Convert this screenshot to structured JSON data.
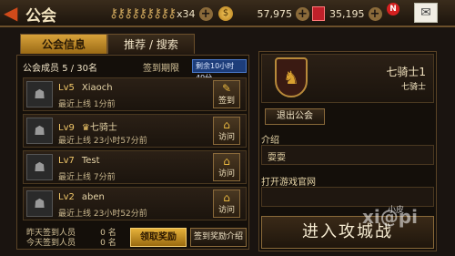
{
  "topbar": {
    "title": "公会",
    "key_count": "x34",
    "gold": "57,975",
    "gems": "35,195",
    "notice_badge": "N"
  },
  "tabs": [
    {
      "label": "公会信息",
      "active": true
    },
    {
      "label": "推荐 / 搜索",
      "active": false
    }
  ],
  "member_list": {
    "members_label": "公会成员",
    "members_count": "5 / 30名",
    "deadline_label": "签到期限",
    "remaining": "剩余10小时49分",
    "rows": [
      {
        "level": "Lv5",
        "name": "Xiaoch",
        "last_online": "最近上线 1分前",
        "action": "签到",
        "action_icon": "✎",
        "crown": ""
      },
      {
        "level": "Lv9",
        "name": "七骑士",
        "last_online": "最近上线 23小时57分前",
        "action": "访问",
        "action_icon": "⌂",
        "crown": "♛"
      },
      {
        "level": "Lv7",
        "name": "Test",
        "last_online": "最近上线 7分前",
        "action": "访问",
        "action_icon": "⌂",
        "crown": ""
      },
      {
        "level": "Lv2",
        "name": "aben",
        "last_online": "最近上线 23小时52分前",
        "action": "访问",
        "action_icon": "⌂",
        "crown": ""
      }
    ],
    "yesterday_label": "昨天签到人员",
    "yesterday_count": "0",
    "today_label": "今天签到人员",
    "today_count": "0",
    "unit": "名",
    "claim_label": "领取奖励",
    "intro_label": "签到奖励介绍"
  },
  "guild": {
    "name": "七骑士1",
    "leader": "七骑士",
    "leave_label": "退出公会",
    "intro_label": "介绍",
    "intro_text": "耍耍",
    "site_label": "打开游戏官网",
    "site_text": "",
    "enter_label": "进入攻城战"
  },
  "watermark": {
    "main": "xi@pi",
    "small": "小皮"
  },
  "colors": {
    "accent": "#d8a23a",
    "remain_bg": "#1d3d7a",
    "gem": "#c0202a"
  }
}
